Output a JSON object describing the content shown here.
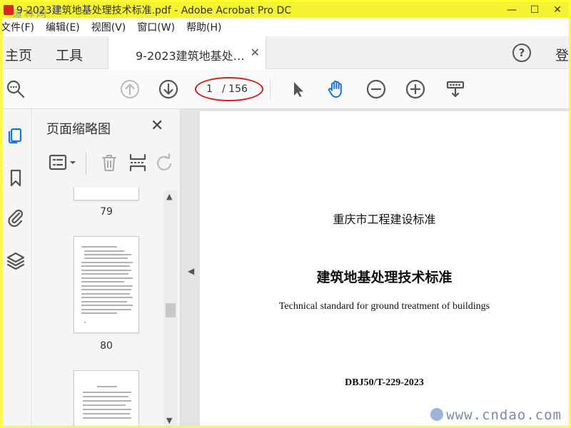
{
  "window": {
    "title": "9-2023建筑地基处理技术标准.pdf - Adobe Acrobat Pro DC",
    "minimize": "—",
    "maximize": "☐",
    "close": "✕"
  },
  "watermarks": {
    "top_left": "道林网",
    "bottom_right": "www.cndao.com"
  },
  "menu": [
    "文件(F)",
    "编辑(E)",
    "视图(V)",
    "窗口(W)",
    "帮助(H)"
  ],
  "tabs": {
    "home": "主页",
    "tools": "工具",
    "document": "9-2023建筑地基处…",
    "document_close": "✕",
    "help": "?",
    "signin": "登"
  },
  "toolbar": {
    "current_page": "1",
    "total_pages": "/ 156",
    "icons": [
      "search-icon",
      "previous-page-icon",
      "next-page-icon",
      "select-cursor-icon",
      "hand-tool-icon",
      "zoom-out-icon",
      "zoom-in-icon",
      "read-mode-icon"
    ]
  },
  "rail": {
    "icons": [
      "page-thumbnails-icon",
      "bookmarks-icon",
      "attachments-icon",
      "layers-icon"
    ]
  },
  "thumbnails_panel": {
    "title": "页面缩略图",
    "close": "✕",
    "pages": [
      "79",
      "80"
    ]
  },
  "document": {
    "line1": "重庆市工程建设标准",
    "line2": "建筑地基处理技术标准",
    "line3": "Technical standard for ground treatment of buildings",
    "line4": "DBJ50/T-229-2023"
  },
  "colors": {
    "frame_border": "#ffff33",
    "annotation_oval": "#d41c1c",
    "active_icon": "#1473e6"
  }
}
